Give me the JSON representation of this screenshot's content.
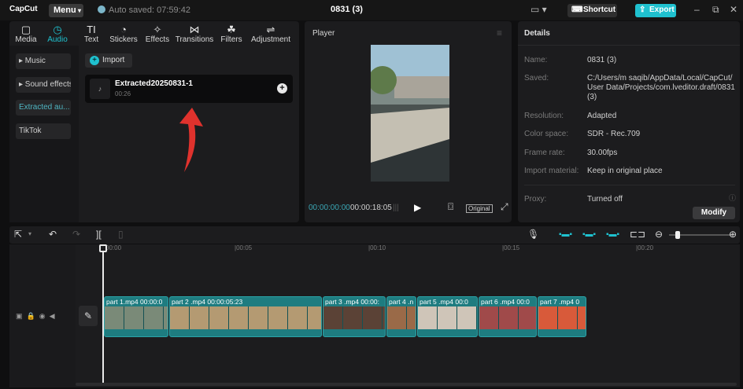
{
  "app": {
    "logo": "CapCut",
    "menu_label": "Menu",
    "autosave": "Auto saved: 07:59:42",
    "project_title": "0831 (3)",
    "shortcut_label": "Shortcut",
    "export_label": "Export"
  },
  "media_tabs": [
    {
      "label": "Media",
      "icon": "▢"
    },
    {
      "label": "Audio",
      "icon": "◷"
    },
    {
      "label": "Text",
      "icon": "TI"
    },
    {
      "label": "Stickers",
      "icon": "◔"
    },
    {
      "label": "Effects",
      "icon": "✧"
    },
    {
      "label": "Transitions",
      "icon": "⋈"
    },
    {
      "label": "Filters",
      "icon": "☘"
    },
    {
      "label": "Adjustment",
      "icon": "⇌"
    }
  ],
  "sidebar": {
    "items": [
      "▸ Music",
      "▸ Sound effects",
      "Extracted au...",
      "TikTok"
    ]
  },
  "import_label": "Import",
  "audio_item": {
    "name": "Extracted20250831-1",
    "duration": "00:26"
  },
  "player": {
    "title": "Player",
    "current_time": "00:00:00:00",
    "total_time": "00:00:18:05",
    "ratio_label": "Original"
  },
  "details": {
    "title": "Details",
    "rows": [
      {
        "label": "Name:",
        "value": "0831 (3)"
      },
      {
        "label": "Saved:",
        "value": "C:/Users/m saqib/AppData/Local/CapCut/ User Data/Projects/com.lveditor.draft/0831 (3)"
      },
      {
        "label": "Resolution:",
        "value": "Adapted"
      },
      {
        "label": "Color space:",
        "value": "SDR - Rec.709"
      },
      {
        "label": "Frame rate:",
        "value": "30.00fps"
      },
      {
        "label": "Import material:",
        "value": "Keep in original place"
      },
      {
        "label": "Proxy:",
        "value": "Turned off"
      }
    ],
    "modify_label": "Modify"
  },
  "ruler": [
    "00:00",
    "00:05",
    "00:10",
    "00:15",
    "00:20"
  ],
  "clips": [
    {
      "label": "part 1.mp4   00:00:0",
      "color": "#7a8a78"
    },
    {
      "label": "part 2 .mp4    00:00:05:23",
      "color": "#b49a72"
    },
    {
      "label": "part 3 .mp4   00:00:",
      "color": "#5b4236"
    },
    {
      "label": "part 4 .n",
      "color": "#9a6a48"
    },
    {
      "label": "part 5 .mp4   00:0",
      "color": "#cfc5b8"
    },
    {
      "label": "part 6 .mp4   00:0",
      "color": "#a04a4a"
    },
    {
      "label": "part 7 .mp4   0",
      "color": "#d85a3a"
    }
  ],
  "colors": {
    "accent": "#1fc1cf",
    "clip": "#1e7c80"
  }
}
